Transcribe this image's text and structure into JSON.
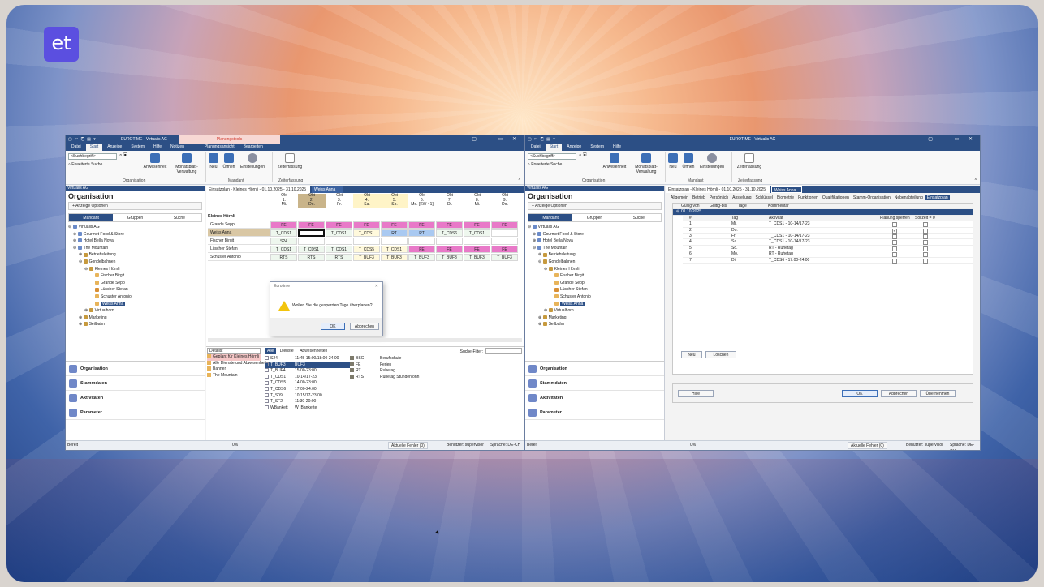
{
  "logo": "et",
  "w1": {
    "title": "EUROTIME - Virtualis AG",
    "tooltab": "Planungstools",
    "menu": [
      "Datei",
      "Start",
      "Anzeige",
      "System",
      "Hilfe",
      "Notizen",
      "Planungsansicht",
      "Bearbeiten"
    ],
    "search_placeholder": "<Suchbegriff>",
    "ext_search": "Erweiterte Suche",
    "ribbon_btns": [
      "Anwesenheit",
      "Monatsblatt-Verwaltung",
      "Neu",
      "Öffnen",
      "Einstellungen",
      "Zeiterfassung"
    ],
    "groups": [
      "Organisation",
      "Mandant",
      "Zeiterfassung"
    ],
    "left_head": "Virtualis AG",
    "left_title": "Organisation",
    "opt": "+ Anzeige Optionen",
    "lp_tabs": [
      "Mandant",
      "Gruppen",
      "Suche"
    ],
    "tree": [
      "Virtualis AG",
      "Gourmet Food & Store",
      "Hotel Bella Nova",
      "The Mountain",
      "Betriebsleitung",
      "Gondelbahnen",
      "Kleines Hörnli",
      "Fischer Birgit",
      "Grande Sepp",
      "Lüscher Stefan",
      "Schuster Antonio",
      "Weiss Anna",
      "Virtualhorn",
      "Marketing",
      "Seilbahn"
    ],
    "nav": [
      "Organisation",
      "Stammdaten",
      "Aktivitäten",
      "Parameter"
    ],
    "doctabs": [
      "Einsatzplan - Kleines Hörnli - 01.10.2025 - 31.10.2025",
      "Weiss Anna"
    ],
    "days": [
      [
        "Okt",
        "1.",
        "Mi."
      ],
      [
        "Okt",
        "2.",
        "Do."
      ],
      [
        "Okt",
        "3.",
        "Fr."
      ],
      [
        "Okt",
        "4.",
        "Sa."
      ],
      [
        "Okt",
        "5.",
        "So."
      ],
      [
        "Okt",
        "6.",
        "Mo. [KW 41]"
      ],
      [
        "Okt",
        "7.",
        "Di."
      ],
      [
        "Okt",
        "8.",
        "Mi."
      ],
      [
        "Okt",
        "9.",
        "Do."
      ]
    ],
    "group_label": "Kleines Hörnli",
    "rows": [
      {
        "name": "Grande Sepp",
        "cells": [
          "FE",
          "FE",
          "FE",
          "FE",
          "FE",
          "FE",
          "FE",
          "FE",
          "FE"
        ]
      },
      {
        "name": "Weiss Anna",
        "cells": [
          "T_CDS1",
          "",
          "T_CDS1",
          "T_CDS1",
          "RT",
          "RT",
          "T_CDS6",
          "T_CDS1",
          ""
        ]
      },
      {
        "name": "Fischer Birgit",
        "cells": [
          "S24",
          "",
          "",
          "",
          "",
          "",
          "",
          "",
          ""
        ]
      },
      {
        "name": "Lüscher Stefan",
        "cells": [
          "T_CDS1",
          "T_CDS1",
          "T_CDS1",
          "T_CDS5",
          "T_CDS1",
          "FE",
          "FE",
          "FE",
          "FE"
        ]
      },
      {
        "name": "Schuster Antonio",
        "cells": [
          "RTS",
          "RTS",
          "RTS",
          "T_BUF3",
          "T_BUF3",
          "T_BUF3",
          "T_BUF3",
          "T_BUF3",
          "T_BUF3"
        ]
      }
    ],
    "dialog": {
      "title": "Eurotime",
      "message": "Wollen Sie die gesperrten Tage überplanen?",
      "ok": "OK",
      "cancel": "Abbrechen"
    },
    "details_label": "Details:",
    "details_items": [
      "Geplant für Kleines Hörnli",
      "Alle Dienste und Abwesenheiten",
      "Bahnen",
      "The Mountain"
    ],
    "svc_tabs": [
      "Alle",
      "Dienste",
      "Abwesenheiten"
    ],
    "search_filter": "Suche-Filter:",
    "services": [
      [
        "S24",
        "11:45-15:00/18:00-24:00"
      ],
      [
        "T_BUF3",
        "BUF3"
      ],
      [
        "T_BUF4",
        "15:00-23:00"
      ],
      [
        "T_CDS1",
        "10-14/17-23"
      ],
      [
        "T_CDS5",
        "14:00-23:00"
      ],
      [
        "T_CDS6",
        "17:00-24:00"
      ],
      [
        "T_S09",
        "10:15/17-23:00"
      ],
      [
        "T_SF2",
        "11:30-20:00"
      ],
      [
        "WBankett",
        "W_Bankette"
      ]
    ],
    "absences": [
      [
        "BSC",
        "Berufschule"
      ],
      [
        "FE",
        "Ferien"
      ],
      [
        "RT",
        "Ruhetag"
      ],
      [
        "RTS",
        "Ruhetag Stundenlohn"
      ]
    ],
    "status": {
      "ready": "Bereit",
      "pct": "0%",
      "errors": "Aktuelle Fehler (0)",
      "user": "Benutzer: supervisor",
      "lang": "Sprache: DE-CH"
    }
  },
  "w2": {
    "title": "EUROTIME - Virtualis AG",
    "menu": [
      "Datei",
      "Start",
      "Anzeige",
      "System",
      "Hilfe"
    ],
    "doctabs": [
      "Einsatzplan - Kleines Hörnli - 01.10.2025 - 31.10.2025",
      "Weiss Anna"
    ],
    "subtabs": [
      "Allgemein",
      "Betrieb",
      "Persönlich",
      "Anstellung",
      "Schlüssel",
      "Biometrie",
      "Funktionen",
      "Qualifikationen",
      "Stamm-Organisation",
      "Nebenabteilung",
      "Einsatzplan"
    ],
    "outer_cols": [
      "Gültig von",
      "Gültig-bis",
      "Tage",
      "Kommentar"
    ],
    "outer_row": "01.10.2025",
    "inner_cols": [
      "#",
      "Tag",
      "Aktivität",
      "Planung sperren",
      "Sollzeit = 0"
    ],
    "inner_rows": [
      [
        "1",
        "Mi.",
        "T_CDS1 - 10-14/17-23",
        false
      ],
      [
        "2",
        "Do.",
        "",
        true
      ],
      [
        "3",
        "Fr.",
        "T_CDS1 - 10-14/17-23",
        false
      ],
      [
        "4",
        "Sa.",
        "T_CDS1 - 10-14/17-23",
        false
      ],
      [
        "5",
        "So.",
        "RT - Ruhetag",
        false
      ],
      [
        "6",
        "Mo.",
        "RT - Ruhetag",
        false
      ],
      [
        "7",
        "Di.",
        "T_CDS6 - 17:00-24:00",
        false
      ]
    ],
    "btns": {
      "new": "Neu",
      "del": "Löschen",
      "help": "Hilfe",
      "ok": "OK",
      "cancel": "Abbrechen",
      "apply": "Übernehmen"
    },
    "status": {
      "ready": "Bereit",
      "pct": "0%",
      "errors": "Aktuelle Fehler (0)",
      "user": "Benutzer: supervisor",
      "lang": "Sprache: DE-CH"
    }
  },
  "colors": {
    "accent": "#2c4f85",
    "fe": "#e879c8",
    "rt": "#a9c9f1",
    "wk": "#fff4c7"
  }
}
